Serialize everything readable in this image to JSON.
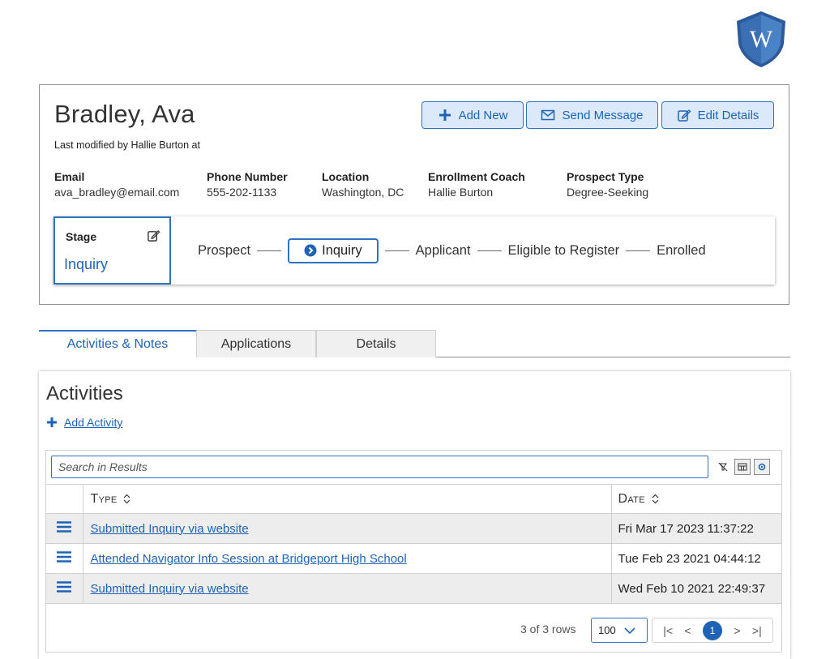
{
  "profile": {
    "name": "Bradley, Ava",
    "modified": "Last modified by Hallie Burton at",
    "buttons": {
      "add_new": "Add New",
      "send_message": "Send Message",
      "edit_details": "Edit Details"
    },
    "fields": [
      {
        "label": "Email",
        "value": "ava_bradley@email.com"
      },
      {
        "label": "Phone Number",
        "value": "555-202-1133"
      },
      {
        "label": "Location",
        "value": "Washington, DC"
      },
      {
        "label": "Enrollment Coach",
        "value": "Hallie Burton"
      },
      {
        "label": "Prospect Type",
        "value": "Degree-Seeking"
      }
    ],
    "stage": {
      "label": "Stage",
      "value": "Inquiry",
      "steps": [
        "Prospect",
        "Inquiry",
        "Applicant",
        "Eligible to Register",
        "Enrolled"
      ],
      "active_step": "Inquiry"
    }
  },
  "tabs": [
    "Activities & Notes",
    "Applications",
    "Details"
  ],
  "activities": {
    "title": "Activities",
    "add_link": "Add Activity",
    "search_placeholder": "Search in Results",
    "columns": {
      "type": "Type",
      "date": "Date"
    },
    "rows": [
      {
        "type": "Submitted Inquiry via website",
        "date": "Fri Mar 17 2023 11:37:22"
      },
      {
        "type": "Attended Navigator Info Session at Bridgeport High School",
        "date": "Tue Feb 23 2021 04:44:12"
      },
      {
        "type": "Submitted Inquiry via website",
        "date": "Wed Feb 10 2021 22:49:37"
      }
    ],
    "pager": {
      "rows_text": "3 of 3 rows",
      "page_size": "100",
      "current_page": "1",
      "first": "|<",
      "prev": "<",
      "next": ">",
      "last": ">|"
    }
  },
  "colors": {
    "accent": "#1f63b6",
    "button_bg": "#dbe9fb",
    "shield": "#3b6fb3"
  },
  "logo": {
    "letter": "W"
  }
}
